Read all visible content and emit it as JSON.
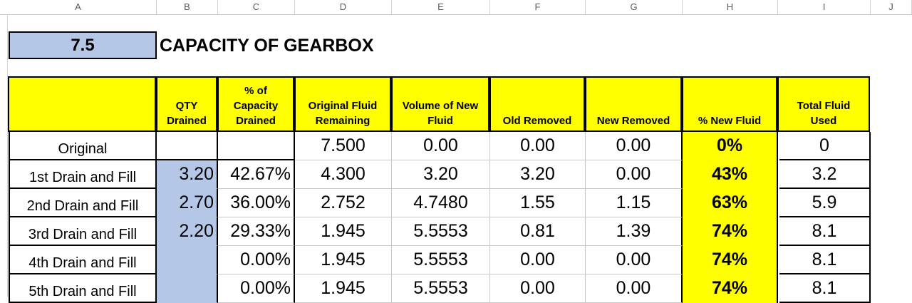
{
  "columns": [
    "A",
    "B",
    "C",
    "D",
    "E",
    "F",
    "G",
    "H",
    "I",
    "J"
  ],
  "section": {
    "number": "7.5",
    "title": "CAPACITY OF GEARBOX"
  },
  "headers": {
    "qty_drained": [
      "QTY",
      "Drained"
    ],
    "pct_capacity_drained": [
      "% of",
      "Capacity",
      "Drained"
    ],
    "original_fluid_remaining": [
      "Original Fluid",
      "Remaining"
    ],
    "volume_new_fluid": [
      "Volume of New",
      "Fluid"
    ],
    "old_removed": [
      "Old Removed"
    ],
    "new_removed": [
      "New Removed"
    ],
    "pct_new_fluid": [
      "% New Fluid"
    ],
    "total_fluid_used": [
      "Total Fluid",
      "Used"
    ]
  },
  "rows": [
    {
      "label": "Original",
      "qty": "",
      "pct": "",
      "orig": "7.500",
      "vol": "0.00",
      "old": "0.00",
      "new": "0.00",
      "pnew": "0%",
      "total": "0"
    },
    {
      "label": "1st Drain and Fill",
      "qty": "3.20",
      "pct": "42.67%",
      "orig": "4.300",
      "vol": "3.20",
      "old": "3.20",
      "new": "0.00",
      "pnew": "43%",
      "total": "3.2"
    },
    {
      "label": "2nd Drain and Fill",
      "qty": "2.70",
      "pct": "36.00%",
      "orig": "2.752",
      "vol": "4.7480",
      "old": "1.55",
      "new": "1.15",
      "pnew": "63%",
      "total": "5.9"
    },
    {
      "label": "3rd Drain and Fill",
      "qty": "2.20",
      "pct": "29.33%",
      "orig": "1.945",
      "vol": "5.5553",
      "old": "0.81",
      "new": "1.39",
      "pnew": "74%",
      "total": "8.1"
    },
    {
      "label": "4th Drain and Fill",
      "qty": "",
      "pct": "0.00%",
      "orig": "1.945",
      "vol": "5.5553",
      "old": "0.00",
      "new": "0.00",
      "pnew": "74%",
      "total": "8.1"
    },
    {
      "label": "5th Drain and Fill",
      "qty": "",
      "pct": "0.00%",
      "orig": "1.945",
      "vol": "5.5553",
      "old": "0.00",
      "new": "0.00",
      "pnew": "74%",
      "total": "8.1"
    }
  ],
  "colors": {
    "yellow": "#ffff00",
    "blue": "#b4c7e7"
  }
}
